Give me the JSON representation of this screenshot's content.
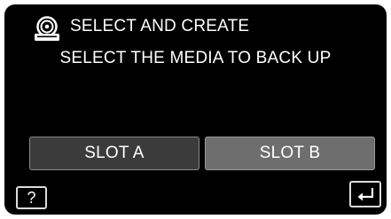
{
  "header": {
    "title": "SELECT AND CREATE",
    "icon": "disc-create-icon"
  },
  "subtitle": "SELECT THE MEDIA TO BACK UP",
  "buttons": {
    "slot_a": "SLOT A",
    "slot_b": "SLOT B",
    "help": "?",
    "back_icon": "return-arrow-icon"
  },
  "colors": {
    "background": "#000000",
    "slot_a_bg": "#3b3b3b",
    "slot_b_bg": "#6e6e6e",
    "text": "#ffffff"
  }
}
